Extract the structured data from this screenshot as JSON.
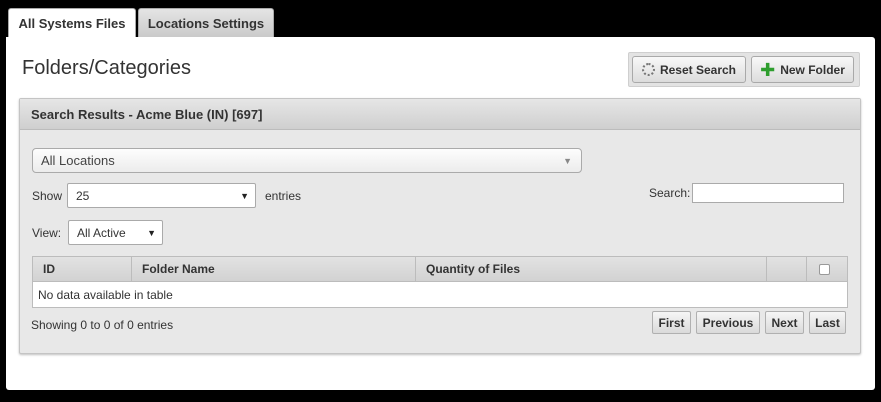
{
  "tabs": [
    {
      "label": "All Systems Files",
      "active": true
    },
    {
      "label": "Locations Settings",
      "active": false
    }
  ],
  "page_title": "Folders/Categories",
  "toolbar": {
    "reset_label": "Reset Search",
    "new_folder_label": "New Folder"
  },
  "results": {
    "header": "Search Results - Acme Blue (IN) [697]",
    "location_select": "All Locations",
    "show_label": "Show",
    "entries_value": "25",
    "entries_label": "entries",
    "search_label": "Search:",
    "search_value": "",
    "view_label": "View:",
    "view_value": "All Active",
    "columns": [
      "ID",
      "Folder Name",
      "Quantity of Files",
      ""
    ],
    "empty_message": "No data available in table",
    "info": "Showing 0 to 0 of 0 entries",
    "pagination": [
      "First",
      "Previous",
      "Next",
      "Last"
    ]
  },
  "icons": {
    "reset": "gear-icon",
    "new_folder": "plus-icon",
    "dropdown": "caret-down-icon"
  },
  "colors": {
    "accent_green": "#2e9e2e",
    "header_bg": "#d6d6d6"
  }
}
